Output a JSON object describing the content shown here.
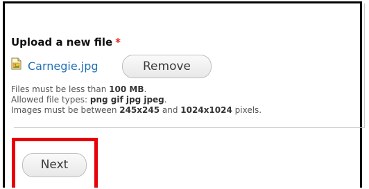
{
  "form": {
    "field_label": "Upload a new file",
    "required_marker": "*",
    "file_name": "Carnegie.jpg",
    "remove_label": "Remove",
    "desc_size_prefix": "Files must be less than ",
    "desc_size_value": "100 MB",
    "desc_size_suffix": ".",
    "desc_types_prefix": "Allowed file types: ",
    "desc_types_value": "png gif jpg jpeg",
    "desc_types_suffix": ".",
    "desc_dims_prefix": "Images must be between ",
    "desc_dims_min": "245x245",
    "desc_dims_and": " and ",
    "desc_dims_max": "1024x1024",
    "desc_dims_suffix": " pixels.",
    "next_label": "Next"
  },
  "colors": {
    "highlight": "#e8000a",
    "link": "#1f6fb5",
    "required": "#e02020"
  },
  "icons": {
    "file_icon": "image-file-icon"
  }
}
